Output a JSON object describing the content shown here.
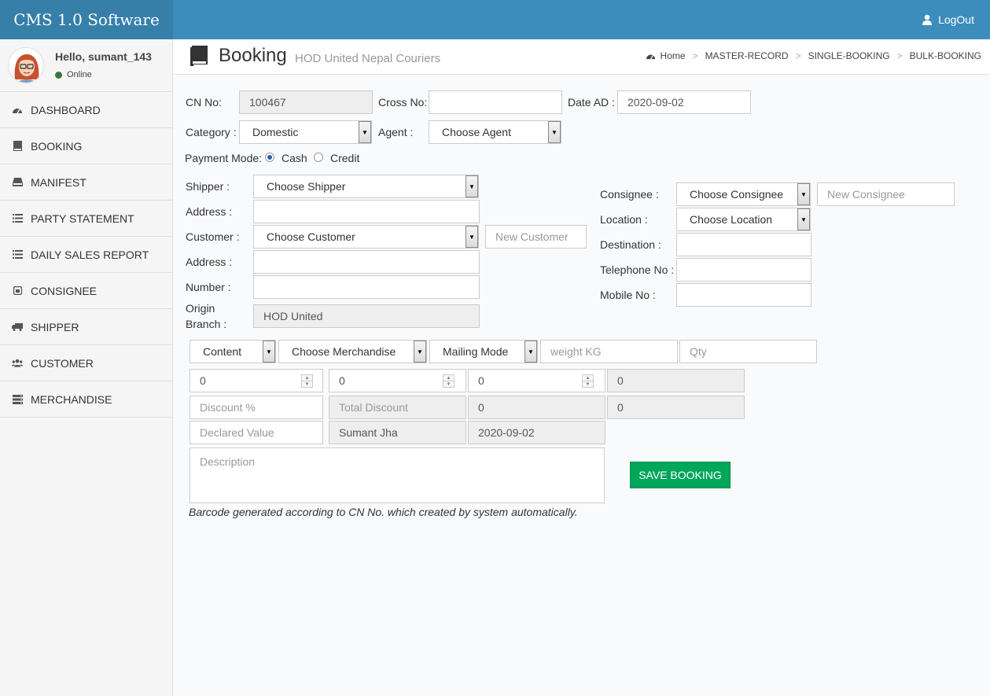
{
  "app": {
    "title": "CMS 1.0 Software"
  },
  "header": {
    "logout_label": "LogOut"
  },
  "user": {
    "greeting": "Hello, sumant_143",
    "status": "Online"
  },
  "sidebar": {
    "items": [
      {
        "label": "DASHBOARD",
        "icon": "dashboard-icon"
      },
      {
        "label": "BOOKING",
        "icon": "book-icon"
      },
      {
        "label": "MANIFEST",
        "icon": "hdd-icon"
      },
      {
        "label": "PARTY STATEMENT",
        "icon": "list-icon"
      },
      {
        "label": "DAILY SALES REPORT",
        "icon": "list-icon"
      },
      {
        "label": "CONSIGNEE",
        "icon": "square-icon"
      },
      {
        "label": "SHIPPER",
        "icon": "truck-icon"
      },
      {
        "label": "CUSTOMER",
        "icon": "users-icon"
      },
      {
        "label": "MERCHANDISE",
        "icon": "server-icon"
      }
    ]
  },
  "page": {
    "title": "Booking",
    "subtitle": "HOD United Nepal Couriers"
  },
  "breadcrumb": [
    "Home",
    "MASTER-RECORD",
    "SINGLE-BOOKING",
    "BULK-BOOKING"
  ],
  "form": {
    "cn_no": {
      "label": "CN No:",
      "value": "100467"
    },
    "cross_no": {
      "label": "Cross No:",
      "value": ""
    },
    "date_ad": {
      "label": "Date AD :",
      "value": "2020-09-02"
    },
    "category": {
      "label": "Category :",
      "value": "Domestic"
    },
    "agent": {
      "label": "Agent :",
      "value": "Choose Agent"
    },
    "payment_mode": {
      "label": "Payment Mode:",
      "options": [
        "Cash",
        "Credit"
      ],
      "selected": "Cash"
    },
    "shipper": {
      "label": "Shipper :",
      "value": "Choose Shipper"
    },
    "shipper_address": {
      "label": "Address :",
      "value": ""
    },
    "customer": {
      "label": "Customer :",
      "value": "Choose Customer",
      "new_placeholder": "New Customer"
    },
    "customer_address": {
      "label": "Address :",
      "value": ""
    },
    "number": {
      "label": "Number :",
      "value": ""
    },
    "origin_branch": {
      "label_line1": "Origin",
      "label_line2": "Branch :",
      "value": "HOD United"
    },
    "consignee": {
      "label": "Consignee :",
      "value": "Choose Consignee",
      "new_placeholder": "New Consignee"
    },
    "location": {
      "label": "Location :",
      "value": "Choose Location"
    },
    "destination": {
      "label": "Destination :",
      "value": ""
    },
    "telephone": {
      "label": "Telephone No :",
      "value": ""
    },
    "mobile": {
      "label": "Mobile No :",
      "value": ""
    },
    "content": "Content",
    "merchandise": "Choose Merchandise",
    "mailing_mode": "Mailing Mode",
    "weight_placeholder": "weight KG",
    "qty_placeholder": "Qty",
    "num1": "0",
    "num2": "0",
    "num3": "0",
    "num4": "0",
    "discount_placeholder": "Discount %",
    "total_discount_placeholder": "Total Discount",
    "amount1": "0",
    "amount2": "0",
    "declared_value_placeholder": "Declared Value",
    "created_by": "Sumant Jha",
    "created_date": "2020-09-02",
    "description_placeholder": "Description",
    "save_label": "SAVE BOOKING",
    "note": "Barcode generated according to CN No. which created by system automatically."
  }
}
